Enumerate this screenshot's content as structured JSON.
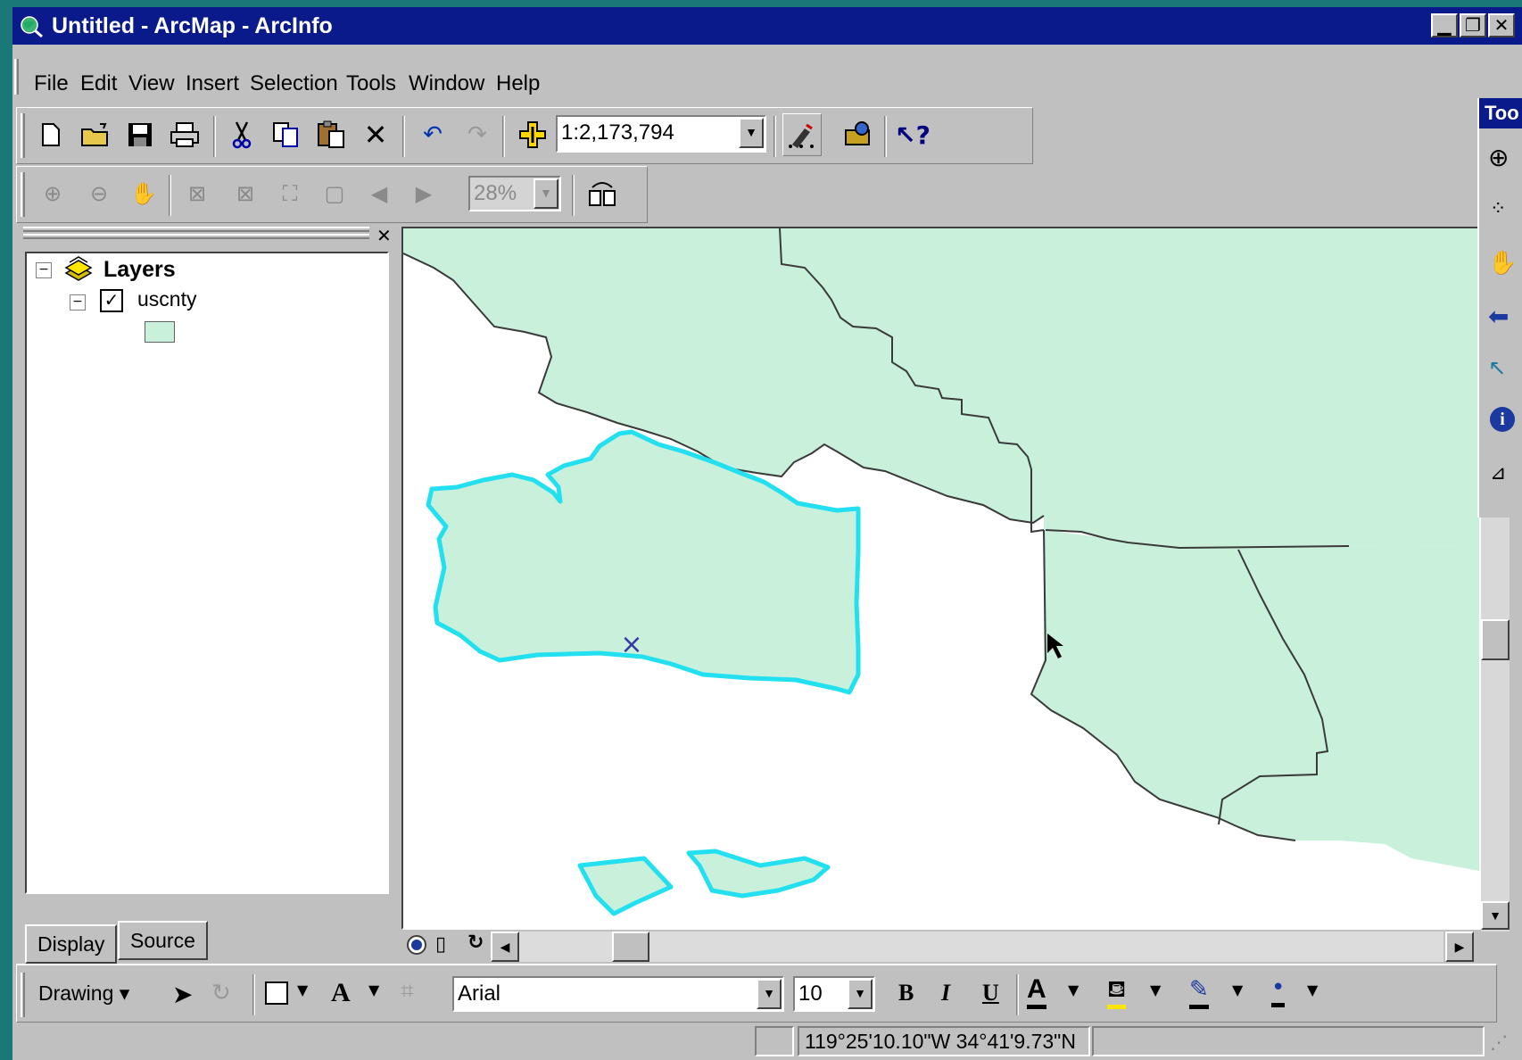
{
  "window": {
    "title": "Untitled - ArcMap - ArcInfo",
    "controls": [
      "▁",
      "❐",
      "✕"
    ]
  },
  "menu": [
    "File",
    "Edit",
    "View",
    "Insert",
    "Selection",
    "Tools",
    "Window",
    "Help"
  ],
  "standard_toolbar": {
    "scale": "1:2,173,794",
    "buttons": [
      "new-icon",
      "open-icon",
      "save-icon",
      "print-icon",
      "cut-icon",
      "copy-icon",
      "paste-icon",
      "delete-icon",
      "undo-icon",
      "redo-icon",
      "add-data-icon",
      "editor-icon",
      "arctoolbox-icon",
      "whats-this-icon"
    ]
  },
  "layout_toolbar": {
    "zoom": "28%"
  },
  "toc": {
    "root_label": "Layers",
    "layer_label": "uscnty",
    "layer_checked": true,
    "tabs": [
      "Display",
      "Source"
    ]
  },
  "tools_toolbar": {
    "title": "Too"
  },
  "drawing_toolbar": {
    "drawing_label": "Drawing",
    "font": "Arial",
    "font_size": "10",
    "bold": "B",
    "italic": "I",
    "underline": "U"
  },
  "status": {
    "coordinates": "119°25'10.10\"W  34°41'9.73\"N"
  },
  "colors": {
    "title_bar": "#0a1a8a",
    "county_fill": "#c8f0da",
    "selection_outline": "#22e0f0",
    "chrome": "#c0c0c0"
  }
}
